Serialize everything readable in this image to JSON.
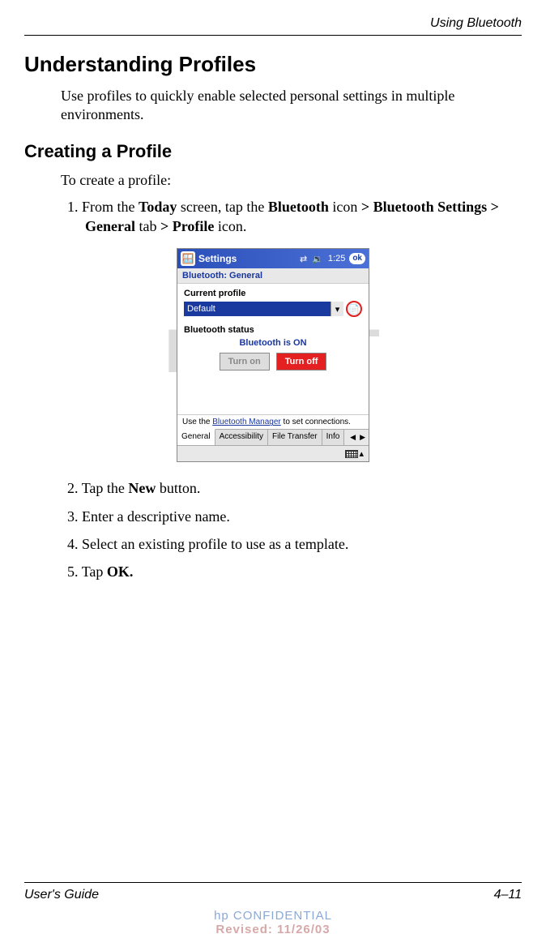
{
  "header": {
    "chapter": "Using Bluetooth"
  },
  "watermark": "DRAFT",
  "h1": "Understanding Profiles",
  "intro": "Use profiles to quickly enable selected personal settings in multiple environments.",
  "h2": "Creating a Profile",
  "lead": "To create a profile:",
  "steps": {
    "s1": {
      "num": "1.",
      "pre": "From the ",
      "b1": "Today",
      "mid1": " screen, tap the ",
      "b2": "Bluetooth",
      "mid2": " icon ",
      "gt1": ">",
      "b3": " Bluetooth Settings ",
      "gt2": ">",
      "b4": " General",
      "mid3": " tab ",
      "gt3": ">",
      "b5": " Profile",
      "tail": " icon."
    },
    "s2": {
      "num": "2.",
      "pre": "Tap the ",
      "b1": "New",
      "tail": " button."
    },
    "s3": {
      "num": "3.",
      "text": "Enter a descriptive name."
    },
    "s4": {
      "num": "4.",
      "text": "Select an existing profile to use as a template."
    },
    "s5": {
      "num": "5.",
      "pre": "Tap ",
      "b1": "OK."
    }
  },
  "device": {
    "title": "Settings",
    "time": "1:25",
    "ok": "ok",
    "subtitle": "Bluetooth: General",
    "profile_label": "Current profile",
    "profile_value": "Default",
    "status_label": "Bluetooth status",
    "status_value": "Bluetooth is ON",
    "btn_on": "Turn on",
    "btn_off": "Turn off",
    "hint_pre": "Use the ",
    "hint_link": "Bluetooth Manager",
    "hint_post": " to set connections.",
    "tabs": {
      "t1": "General",
      "t2": "Accessibility",
      "t3": "File Transfer",
      "t4": "Info"
    }
  },
  "footer": {
    "left": "User's Guide",
    "right": "4–11",
    "conf1": "hp CONFIDENTIAL",
    "conf2": "Revised: 11/26/03"
  }
}
